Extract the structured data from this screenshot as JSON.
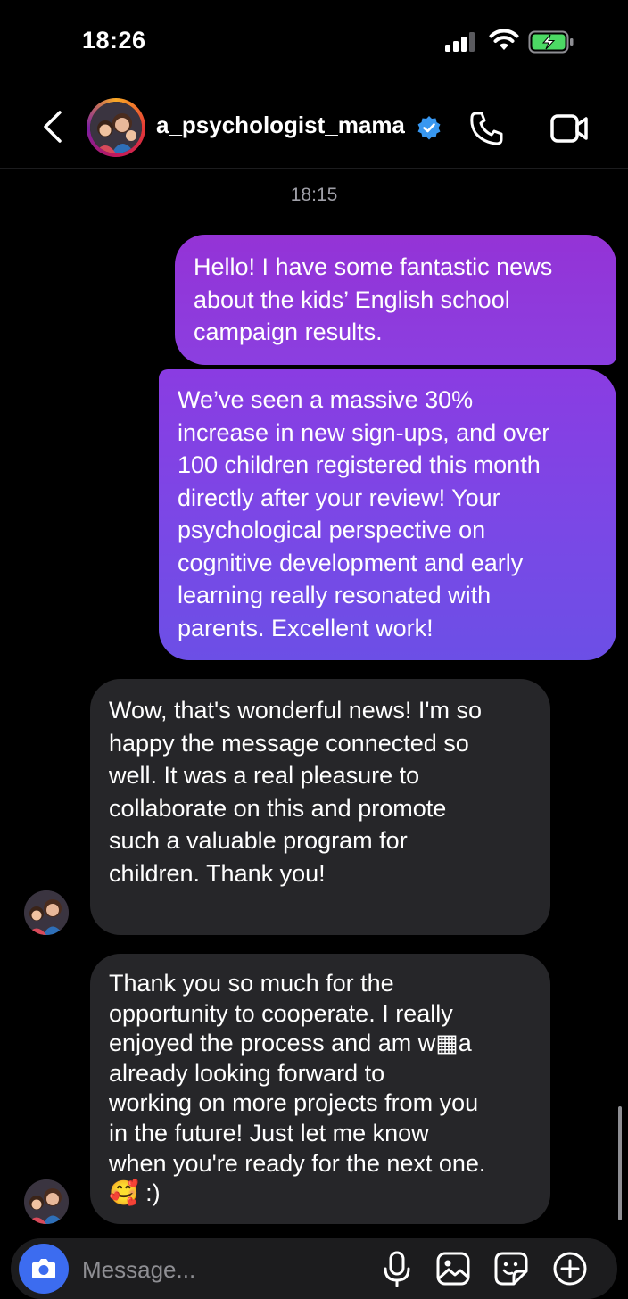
{
  "status_bar": {
    "time": "18:26"
  },
  "header": {
    "username": "a_psychologist_mama",
    "verified": true,
    "icons": [
      "back-arrow-icon",
      "verified-badge-icon",
      "phone-icon",
      "video-camera-icon"
    ]
  },
  "thread": {
    "timestamp": "18:15",
    "messages": [
      {
        "direction": "outgoing",
        "text": "Hello! I have some fantastic news\nabout the kids’ English school\ncampaign results."
      },
      {
        "direction": "outgoing",
        "text": "We’ve seen a massive 30%\nincrease in new sign-ups, and over\n100 children registered this month\ndirectly after your review! Your\npsychological perspective on\ncognitive development and early\nlearning really resonated with\nparents. Excellent work!"
      },
      {
        "direction": "incoming",
        "text": "Wow, that's wonderful news! I'm so\nhappy the message connected so\nwell. It was a real pleasure to\ncollaborate on this and promote\nsuch a valuable program for\nchildren. Thank you!"
      },
      {
        "direction": "incoming",
        "text": "Thank you so much for the\nopportunity to cooperate. I really\nenjoyed the process and am w▦a\nalready looking forward to\nworking on more projects from you\nin the future! Just let me know\nwhen you're ready for the next one.\n🥰 :)"
      }
    ]
  },
  "composer": {
    "placeholder": "Message...",
    "value": "",
    "icons": [
      "camera-icon",
      "microphone-icon",
      "gallery-icon",
      "sticker-icon",
      "plus-icon"
    ]
  },
  "colors": {
    "background": "#000000",
    "outgoing_bubble_top": "#9433d6",
    "outgoing_bubble_bottom": "#6c4fe6",
    "incoming_bubble": "#262629",
    "camera_button": "#3c6cf0",
    "verified_badge": "#3897f0"
  }
}
